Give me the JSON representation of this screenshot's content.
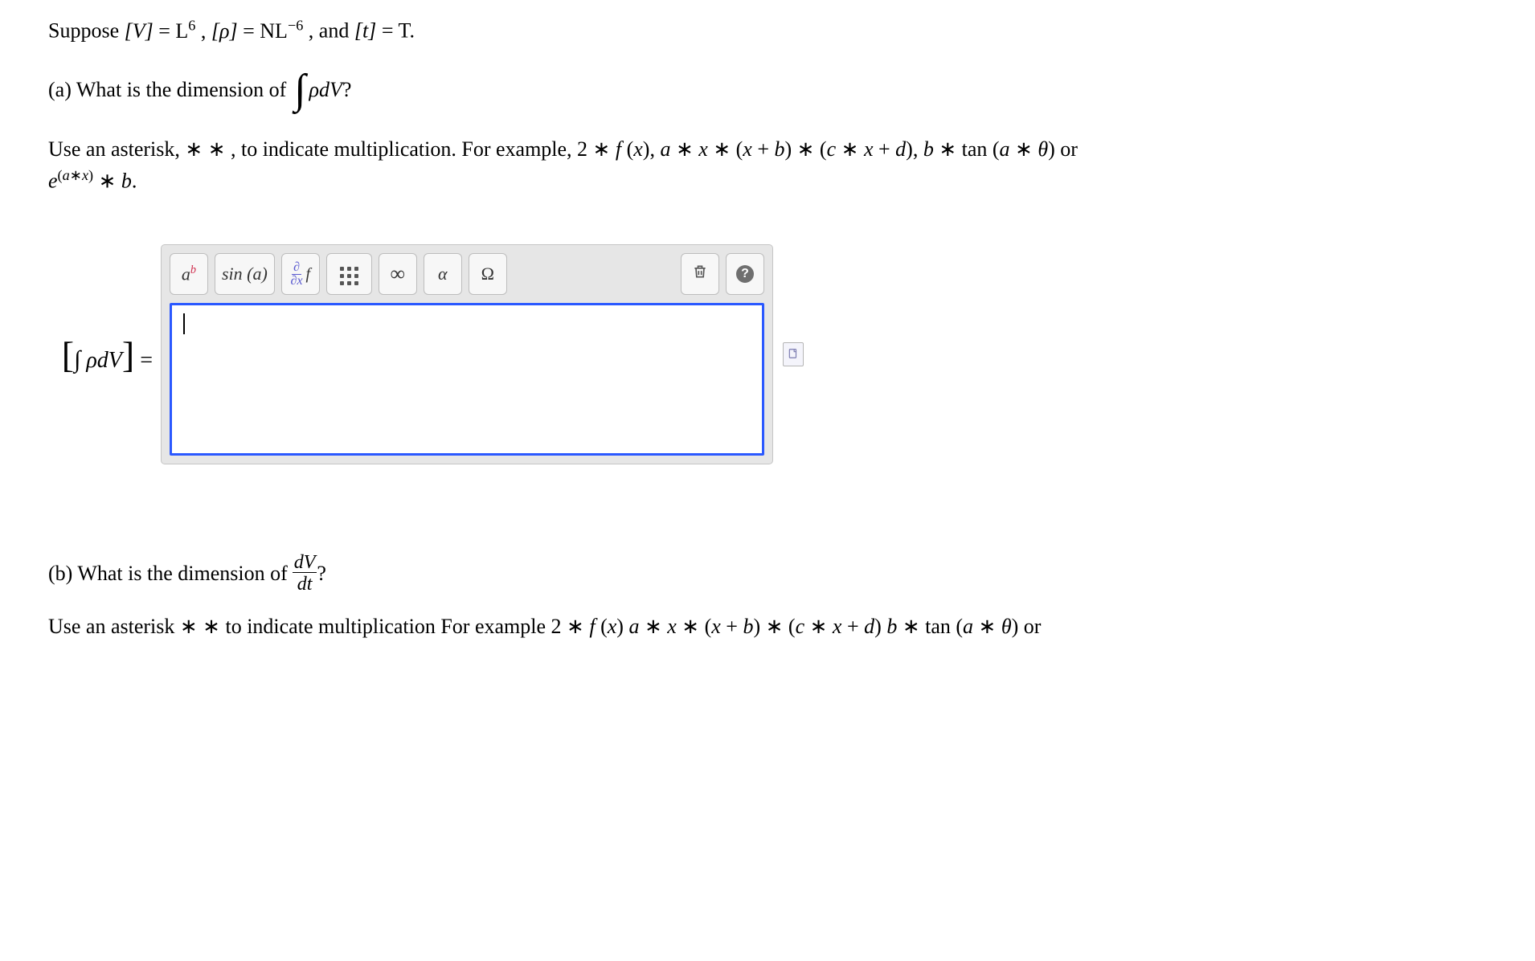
{
  "problem": {
    "suppose_prefix": "Suppose ",
    "V_eq": "[V] = L",
    "V_exp": "6",
    "rho_eq": ", [ρ] = NL",
    "rho_exp": "−6",
    "t_eq": ", and [t] = T.",
    "part_a_prefix": "(a) What is the dimension of ",
    "part_a_int_rho_dV": "ρdV",
    "part_a_qmark": "?",
    "hint_line1_before": "Use an asterisk, ",
    "hint_ast": "∗ ∗",
    "hint_line1_after": ", to indicate multiplication. For example, 2 ∗ f (x), a ∗ x ∗ (x + b) ∗ (c ∗ x + d), b ∗ tan (a ∗ θ) or",
    "hint_line2_exp": "(a∗x)",
    "hint_line2_rest": " ∗ b.",
    "hint_line2_e": "e",
    "answer_a": {
      "left_bracket": "[",
      "integral": "∫",
      "rho_dV": "ρdV",
      "right_bracket": "]",
      "equals": " = "
    },
    "part_b_prefix": "(b) What is the dimension of ",
    "part_b_frac_top": "dV",
    "part_b_frac_bot": "dt",
    "part_b_qmark": "?",
    "hint_b_cut": "Use an asterisk  ∗ ∗  to indicate multiplication  For example  2 ∗ f (x)  a ∗ x ∗ (x + b) ∗ (c ∗ x + d)  b ∗ tan (a ∗ θ) or"
  },
  "toolbar": {
    "exp_a": "a",
    "exp_b": "b",
    "sin_label": "sin (a)",
    "deriv_top": "∂",
    "deriv_bot": "∂x",
    "deriv_f": "f",
    "infty": "∞",
    "alpha": "α",
    "omega": "Ω"
  },
  "icons": {
    "trash": "trash-icon",
    "help": "?",
    "preview": "preview-icon"
  }
}
